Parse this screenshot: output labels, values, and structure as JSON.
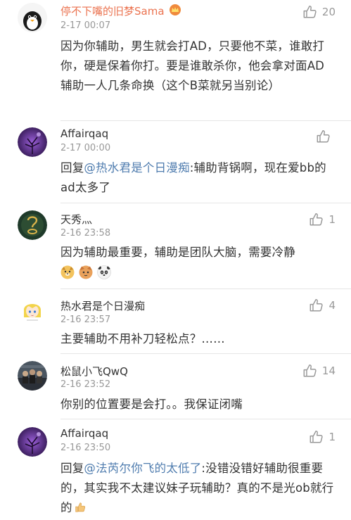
{
  "comments": [
    {
      "name": "停不下嘴的旧梦Sama",
      "time": "2-17 00:07",
      "likes": "20",
      "text": "因为你辅助，男生就会打AD，只要他不菜，谁敢打你，硬是保着你打。要是谁敢杀你，他会拿对面AD辅助一人几条命换（这个B菜就另当别论）"
    },
    {
      "name": "Affairqaq",
      "time": "2-17 00:00",
      "likes": "",
      "reply_prefix": "回复",
      "mention": "@热水君是个日漫痴",
      "text": ":辅助背锅啊，现在爱bb的ad太多了"
    },
    {
      "name": "天秀灬",
      "time": "2-16 23:58",
      "likes": "1",
      "text": "因为辅助最重要，辅助是团队大脑，需要冷静",
      "emoji_names": [
        "dog-emoji",
        "cat-emoji",
        "panda-emoji"
      ]
    },
    {
      "name": "热水君是个日漫痴",
      "time": "2-16 23:57",
      "likes": "4",
      "text": "主要辅助不用补刀轻松点？……"
    },
    {
      "name": "松鼠小飞QwQ",
      "time": "2-16 23:52",
      "likes": "14",
      "text": "你别的位置要是会打。。我保证闭嘴"
    },
    {
      "name": "Affairqaq",
      "time": "2-16 23:50",
      "likes": "1",
      "reply_prefix": "回复",
      "mention": "@法芮尔你飞的太低了",
      "text": ":没错没错好辅助很重要的，其实我不太建议妹子玩辅助？真的不是光ob就行的",
      "trailing_emoji": "thumbs-emoji"
    }
  ]
}
